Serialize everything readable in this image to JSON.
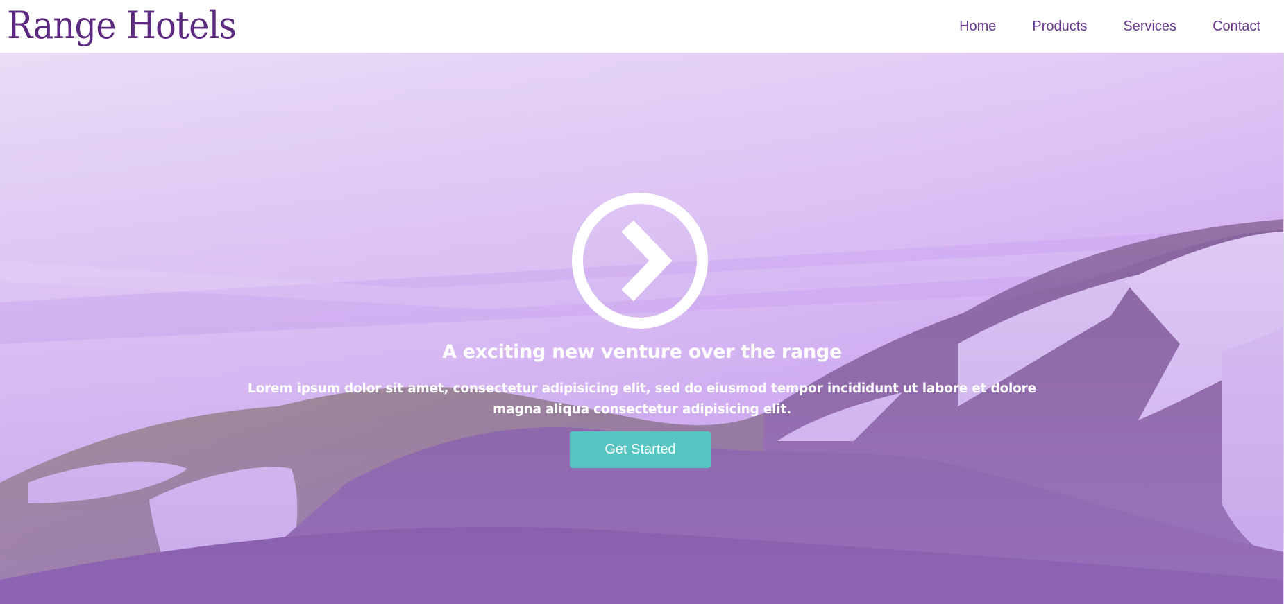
{
  "brand": {
    "logo_text": "Range Hotels",
    "color": "#5b2a7e"
  },
  "nav": {
    "items": [
      {
        "label": "Home"
      },
      {
        "label": "Products"
      },
      {
        "label": "Services"
      },
      {
        "label": "Contact"
      }
    ]
  },
  "hero": {
    "icon": "play-circle-icon",
    "headline": "A exciting new venture over the range",
    "subtext": "Lorem ipsum dolor sit amet, consectetur adipisicing elit, sed do eiusmod tempor incididunt ut labore et dolore magna aliqua consectetur adipisicing elit.",
    "cta_label": "Get Started",
    "cta_color": "#56c4c1",
    "overlay_color": "#b98ae6"
  }
}
